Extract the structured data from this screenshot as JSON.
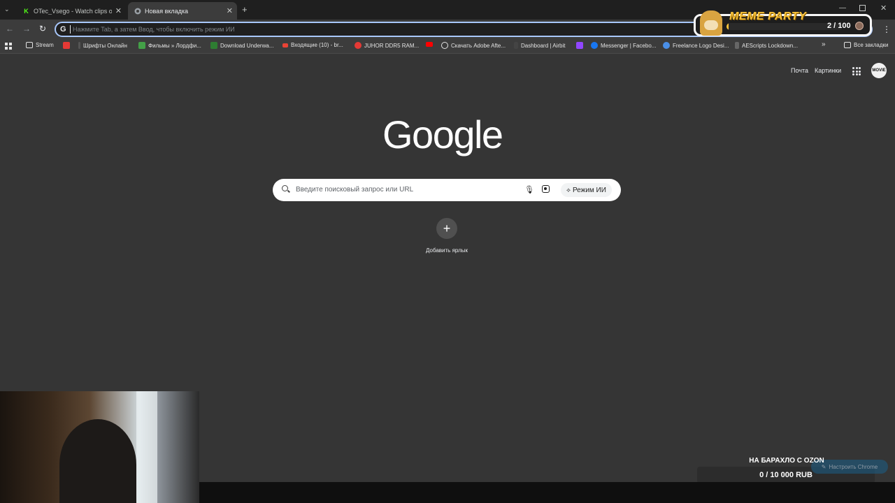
{
  "tabs": [
    {
      "title": "OTec_Vsego - Watch clips on K",
      "icon": "kick-icon",
      "icon_color": "#53fc18"
    },
    {
      "title": "Новая вкладка",
      "icon": "chrome-icon",
      "active": true
    }
  ],
  "omnibox": {
    "placeholder": "Нажмите Tab, а затем Ввод, чтобы включить режим ИИ"
  },
  "bookmarks": [
    {
      "label": "Stream",
      "icon": "folder-icon"
    },
    {
      "label": "",
      "icon": "bookmark-icon",
      "color": "#e53935"
    },
    {
      "label": "Шрифты Онлайн",
      "icon": "bookmark-icon"
    },
    {
      "label": "Фильмы » Лордфи...",
      "icon": "bookmark-icon",
      "color": "#43a047"
    },
    {
      "label": "Download Underwa...",
      "icon": "bookmark-icon",
      "color": "#2e7d32"
    },
    {
      "label": "Входящие (10) - br...",
      "icon": "gmail-icon"
    },
    {
      "label": "JUHOR DDR5 RAM...",
      "icon": "bookmark-icon",
      "color": "#e53935"
    },
    {
      "label": "",
      "icon": "youtube-icon",
      "color": "#ff0000"
    },
    {
      "label": "Скачать Adobe Afte...",
      "icon": "bookmark-icon"
    },
    {
      "label": "Dashboard | Airbit",
      "icon": "bookmark-icon"
    },
    {
      "label": "",
      "icon": "twitch-icon",
      "color": "#9146ff"
    },
    {
      "label": "Messenger | Facebo...",
      "icon": "facebook-icon",
      "color": "#1877f2"
    },
    {
      "label": "Freelance Logo Desi...",
      "icon": "globe-icon"
    },
    {
      "label": "AEScripts Lockdown...",
      "icon": "bookmark-icon"
    }
  ],
  "all_bookmarks": "Все закладки",
  "more_bookmarks": "»",
  "header": {
    "mail": "Почта",
    "images": "Картинки",
    "avatar_text": "MOVIE"
  },
  "logo": "Google",
  "search": {
    "placeholder": "Введите поисковый запрос или URL",
    "ai_mode": "Режим ИИ"
  },
  "shortcut": {
    "label": "Добавить ярлык",
    "plus": "+"
  },
  "meme_party": {
    "title": "MEME PARTY",
    "count": "2 / 100",
    "progress": 0.02
  },
  "goal": {
    "label": "НА БАРАХЛО С OZON",
    "value": "0 / 10 000 RUB"
  },
  "customize": "Настроить Chrome",
  "colors": {
    "omnibox_focus": "#a8c7fa",
    "page_bg": "#353535"
  }
}
